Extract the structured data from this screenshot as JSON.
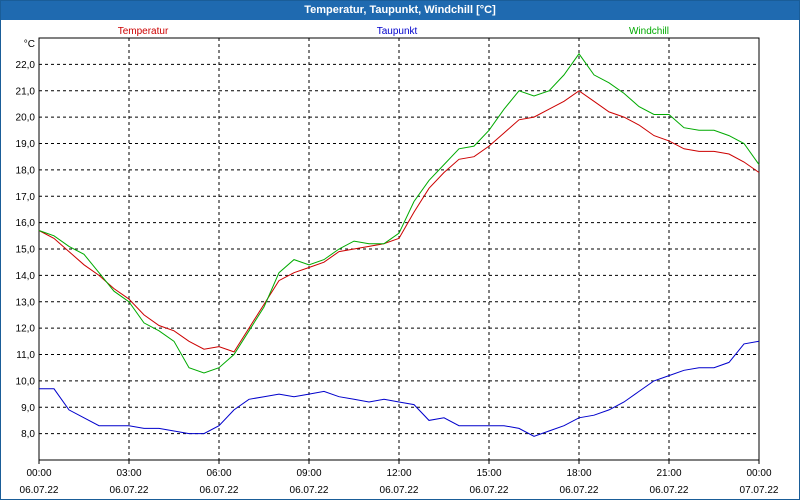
{
  "window": {
    "title": "Temperatur, Taupunkt, Windchill [°C]"
  },
  "colors": {
    "temperatur": "#cc0000",
    "taupunkt": "#0000cc",
    "windchill": "#00aa00",
    "grid": "#000000",
    "titlebar": "#1f6ab0"
  },
  "chart_data": {
    "type": "line",
    "title": "Temperatur, Taupunkt, Windchill [°C]",
    "ylabel": "°C",
    "xlabel": "",
    "ylim": [
      7.0,
      23.0
    ],
    "xlim": [
      0,
      24
    ],
    "grid": true,
    "legend_placement": "top",
    "y_ticks": [
      "8,0",
      "9,0",
      "10,0",
      "11,0",
      "12,0",
      "13,0",
      "14,0",
      "15,0",
      "16,0",
      "17,0",
      "18,0",
      "19,0",
      "20,0",
      "21,0",
      "22,0"
    ],
    "x_ticks": [
      {
        "time": "00:00",
        "date": "06.07.22"
      },
      {
        "time": "03:00",
        "date": "06.07.22"
      },
      {
        "time": "06:00",
        "date": "06.07.22"
      },
      {
        "time": "09:00",
        "date": "06.07.22"
      },
      {
        "time": "12:00",
        "date": "06.07.22"
      },
      {
        "time": "15:00",
        "date": "06.07.22"
      },
      {
        "time": "18:00",
        "date": "06.07.22"
      },
      {
        "time": "21:00",
        "date": "06.07.22"
      },
      {
        "time": "00:00",
        "date": "07.07.22"
      }
    ],
    "series": [
      {
        "name": "Temperatur",
        "x": [
          0,
          0.5,
          1,
          1.5,
          2,
          2.5,
          3,
          3.5,
          4,
          4.5,
          5,
          5.5,
          6,
          6.5,
          7,
          7.5,
          8,
          8.5,
          9,
          9.5,
          10,
          10.5,
          11,
          11.5,
          12,
          12.5,
          13,
          13.5,
          14,
          14.5,
          15,
          15.5,
          16,
          16.5,
          17,
          17.5,
          18,
          18.5,
          19,
          19.5,
          20,
          20.5,
          21,
          21.5,
          22,
          22.5,
          23,
          23.5,
          24
        ],
        "values": [
          15.7,
          15.4,
          14.9,
          14.4,
          14.0,
          13.5,
          13.1,
          12.5,
          12.1,
          11.9,
          11.5,
          11.2,
          11.3,
          11.1,
          12.0,
          12.9,
          13.8,
          14.1,
          14.3,
          14.5,
          14.9,
          15.0,
          15.1,
          15.2,
          15.4,
          16.4,
          17.3,
          17.9,
          18.4,
          18.5,
          18.9,
          19.4,
          19.9,
          20.0,
          20.3,
          20.6,
          21.0,
          20.6,
          20.2,
          20.0,
          19.7,
          19.3,
          19.1,
          18.8,
          18.7,
          18.7,
          18.6,
          18.3,
          17.9
        ]
      },
      {
        "name": "Taupunkt",
        "x": [
          0,
          0.5,
          1,
          1.5,
          2,
          2.5,
          3,
          3.5,
          4,
          4.5,
          5,
          5.5,
          6,
          6.5,
          7,
          7.5,
          8,
          8.5,
          9,
          9.5,
          10,
          10.5,
          11,
          11.5,
          12,
          12.5,
          13,
          13.5,
          14,
          14.5,
          15,
          15.5,
          16,
          16.5,
          17,
          17.5,
          18,
          18.5,
          19,
          19.5,
          20,
          20.5,
          21,
          21.5,
          22,
          22.5,
          23,
          23.5,
          24
        ],
        "values": [
          9.7,
          9.7,
          8.9,
          8.6,
          8.3,
          8.3,
          8.3,
          8.2,
          8.2,
          8.1,
          8.0,
          8.0,
          8.3,
          8.9,
          9.3,
          9.4,
          9.5,
          9.4,
          9.5,
          9.6,
          9.4,
          9.3,
          9.2,
          9.3,
          9.2,
          9.1,
          8.5,
          8.6,
          8.3,
          8.3,
          8.3,
          8.3,
          8.2,
          7.9,
          8.1,
          8.3,
          8.6,
          8.7,
          8.9,
          9.2,
          9.6,
          10.0,
          10.2,
          10.4,
          10.5,
          10.5,
          10.7,
          11.4,
          11.5
        ]
      },
      {
        "name": "Windchill",
        "x": [
          0,
          0.5,
          1,
          1.5,
          2,
          2.5,
          3,
          3.5,
          4,
          4.5,
          5,
          5.5,
          6,
          6.5,
          7,
          7.5,
          8,
          8.5,
          9,
          9.5,
          10,
          10.5,
          11,
          11.5,
          12,
          12.5,
          13,
          13.5,
          14,
          14.5,
          15,
          15.5,
          16,
          16.5,
          17,
          17.5,
          18,
          18.5,
          19,
          19.5,
          20,
          20.5,
          21,
          21.5,
          22,
          22.5,
          23,
          23.5,
          24
        ],
        "values": [
          15.7,
          15.5,
          15.1,
          14.8,
          14.1,
          13.4,
          13.0,
          12.2,
          11.9,
          11.5,
          10.5,
          10.3,
          10.5,
          11.0,
          11.9,
          12.8,
          14.1,
          14.6,
          14.4,
          14.6,
          15.0,
          15.3,
          15.2,
          15.2,
          15.6,
          16.8,
          17.6,
          18.2,
          18.8,
          18.9,
          19.5,
          20.3,
          21.0,
          20.8,
          21.0,
          21.6,
          22.4,
          21.6,
          21.3,
          20.9,
          20.4,
          20.1,
          20.1,
          19.6,
          19.5,
          19.5,
          19.3,
          19.0,
          18.2
        ]
      }
    ]
  }
}
